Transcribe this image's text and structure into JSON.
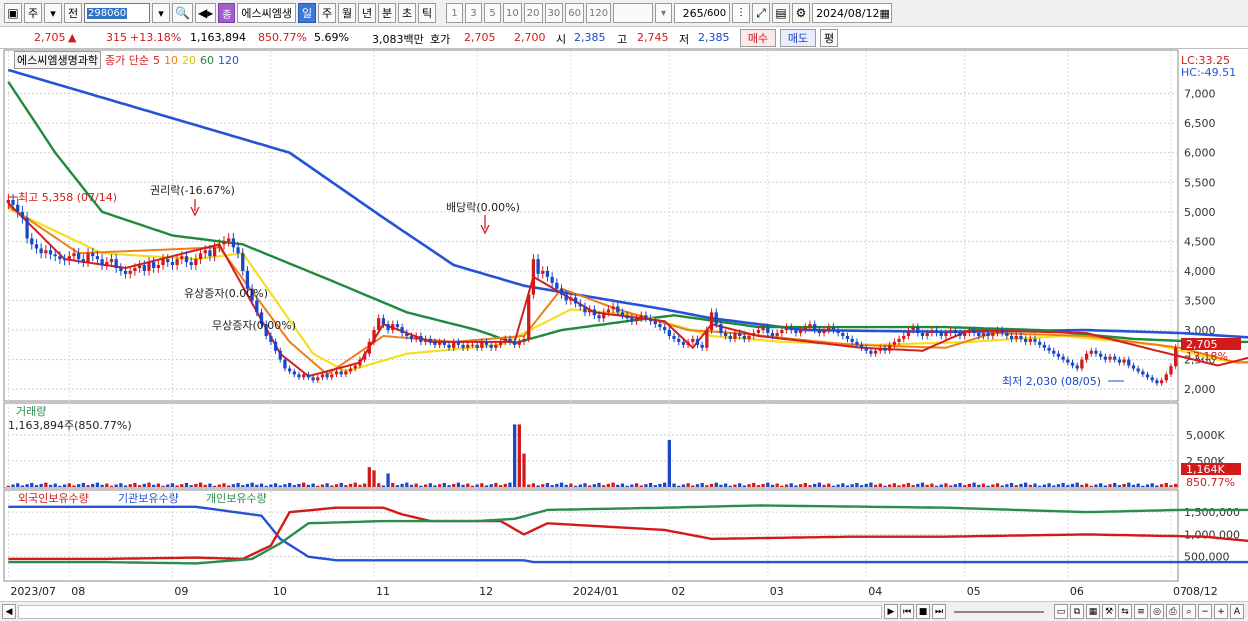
{
  "toolbar": {
    "period_main": "주",
    "prefix": "전",
    "code": "298060",
    "name_tag": "종",
    "stock_name": "에스씨엠생",
    "periods": [
      "일",
      "주",
      "월",
      "년",
      "분",
      "초",
      "틱"
    ],
    "active_period": "일",
    "intervals": [
      "1",
      "3",
      "5",
      "10",
      "20",
      "30",
      "60",
      "120"
    ],
    "count": "265",
    "count_total": "/600",
    "date": "2024/08/12"
  },
  "quote": {
    "price": "2,705",
    "arrow": "▲",
    "change": "315",
    "change_pct": "+13.18%",
    "volume": "1,163,894",
    "volume_pct": "850.77%",
    "turnover": "5.69%",
    "amount": "3,083백만",
    "hoga_label": "호가",
    "ask": "2,705",
    "bid": "2,700",
    "open_label": "시",
    "open": "2,385",
    "high_label": "고",
    "high": "2,745",
    "low_label": "저",
    "low": "2,385",
    "buy_label": "매수",
    "sell_label": "매도",
    "eval_label": "평"
  },
  "legend": {
    "stock": "에스씨엠생명과학",
    "ma_label": "종가 단순",
    "ma_periods": [
      "5",
      "10",
      "20",
      "60",
      "120"
    ]
  },
  "colors": {
    "ma5": "#d31f1f",
    "ma10": "#f07d1a",
    "ma20": "#f3df22",
    "ma60": "#1f8a3a",
    "ma120": "#2453d6",
    "up": "#d21a1a",
    "down": "#1a46c8",
    "foreign": "#2453d6",
    "institution": "#d21a1a",
    "individual": "#2c8c4f"
  },
  "right_labels": {
    "lc": "LC:33.25",
    "hc": "HC:-49.51",
    "price_tag": "2,705",
    "pct_tag": "13.18%",
    "vol_tag": "1,164K",
    "vol_pct_tag": "850.77%"
  },
  "annotations": {
    "high": "최고 5,358 (07/14)",
    "rights": "권리락(-16.67%)",
    "dividend": "배당락(0.00%)",
    "paid_increase": "유상증자(0.00%)",
    "free_increase": "무상증자(0.00%)",
    "low": "최저 2,030 (08/05)"
  },
  "volume_panel": {
    "title": "거래량",
    "info": "1,163,894주(850.77%)"
  },
  "holdings_panel": {
    "legend": [
      "외국인보유수량",
      "기관보유수량",
      "개인보유수량"
    ]
  },
  "chart_data": {
    "type": "line",
    "title": "",
    "price_axis": {
      "ticks": [
        2000,
        2500,
        3000,
        3500,
        4000,
        4500,
        5000,
        5500,
        6000,
        6500,
        7000
      ],
      "tick_labels": [
        "2,000",
        "2,500",
        "3,000",
        "3,500",
        "4,000",
        "4,500",
        "5,000",
        "5,500",
        "6,000",
        "6,500",
        "7,000"
      ],
      "ylim": [
        1800,
        7450
      ]
    },
    "volume_axis": {
      "ticks": [
        2500000,
        5000000
      ],
      "tick_labels": [
        "2,500K",
        "5,000K"
      ],
      "ylim": [
        0,
        7000000
      ]
    },
    "holdings_axis": {
      "ticks": [
        500000,
        1000000,
        1500000
      ],
      "tick_labels": [
        "500,000",
        "1,000,000",
        "1,500,000"
      ],
      "ylim": [
        0,
        1750000
      ]
    },
    "x_labels": [
      "2023/07",
      "08",
      "09",
      "10",
      "11",
      "12",
      "2024/01",
      "02",
      "03",
      "04",
      "05",
      "06",
      "07",
      "08",
      "08/12"
    ],
    "x_label_index": [
      0,
      13,
      35,
      56,
      78,
      100,
      120,
      141,
      162,
      183,
      204,
      226,
      248,
      269,
      285
    ],
    "close": [
      5200,
      5120,
      5000,
      4900,
      4550,
      4450,
      4380,
      4300,
      4350,
      4280,
      4250,
      4200,
      4180,
      4250,
      4300,
      4200,
      4150,
      4300,
      4250,
      4200,
      4100,
      4150,
      4200,
      4050,
      4000,
      3950,
      4000,
      4050,
      4100,
      4000,
      4150,
      4050,
      4100,
      4200,
      4150,
      4100,
      4200,
      4250,
      4150,
      4100,
      4200,
      4300,
      4350,
      4250,
      4400,
      4450,
      4500,
      4550,
      4400,
      4300,
      4000,
      3700,
      3500,
      3300,
      3100,
      2900,
      2800,
      2650,
      2500,
      2350,
      2300,
      2250,
      2200,
      2250,
      2200,
      2150,
      2200,
      2250,
      2200,
      2250,
      2300,
      2250,
      2300,
      2350,
      2400,
      2500,
      2600,
      2800,
      3000,
      3200,
      3100,
      3000,
      3100,
      3050,
      2950,
      2900,
      2850,
      2900,
      2800,
      2850,
      2800,
      2750,
      2800,
      2750,
      2700,
      2800,
      2750,
      2700,
      2750,
      2750,
      2700,
      2800,
      2750,
      2700,
      2750,
      2800,
      2850,
      2800,
      2750,
      2800,
      2850,
      3600,
      4200,
      3950,
      4000,
      3900,
      3800,
      3700,
      3600,
      3500,
      3550,
      3450,
      3400,
      3300,
      3350,
      3250,
      3200,
      3300,
      3350,
      3400,
      3300,
      3250,
      3200,
      3150,
      3200,
      3250,
      3200,
      3150,
      3100,
      3050,
      3000,
      2900,
      2850,
      2800,
      2750,
      2800,
      2850,
      2750,
      2700,
      3000,
      3300,
      3100,
      2950,
      2900,
      2850,
      2950,
      2900,
      2850,
      2900,
      2950,
      3000,
      3050,
      2950,
      2900,
      2950,
      3000,
      3050,
      3000,
      2950,
      3000,
      3050,
      3100,
      3000,
      2950,
      3000,
      3050,
      3000,
      2950,
      2900,
      2850,
      2800,
      2750,
      2700,
      2650,
      2600,
      2650,
      2700,
      2650,
      2750,
      2800,
      2850,
      2900,
      3000,
      3050,
      2950,
      2900,
      2950,
      3000,
      2950,
      2900,
      2950,
      3000,
      2950,
      2900,
      2950,
      3000,
      2950,
      2900,
      2950,
      2900,
      2950,
      3000,
      2950,
      2900,
      2850,
      2900,
      2850,
      2800,
      2850,
      2800,
      2750,
      2700,
      2650,
      2600,
      2550,
      2500,
      2450,
      2400,
      2350,
      2500,
      2600,
      2650,
      2600,
      2550,
      2500,
      2550,
      2500,
      2450,
      2500,
      2400,
      2350,
      2300,
      2250,
      2200,
      2150,
      2100,
      2150,
      2250,
      2390,
      2705
    ],
    "ma5_anchor": [
      [
        0,
        5150
      ],
      [
        12,
        4200
      ],
      [
        25,
        4050
      ],
      [
        45,
        4450
      ],
      [
        58,
        2600
      ],
      [
        64,
        2220
      ],
      [
        75,
        2450
      ],
      [
        80,
        3100
      ],
      [
        90,
        2800
      ],
      [
        108,
        2800
      ],
      [
        112,
        3900
      ],
      [
        125,
        3300
      ],
      [
        140,
        3150
      ],
      [
        146,
        2700
      ],
      [
        150,
        3100
      ],
      [
        160,
        2900
      ],
      [
        182,
        2700
      ],
      [
        195,
        2650
      ],
      [
        205,
        3000
      ],
      [
        230,
        2950
      ],
      [
        245,
        2650
      ],
      [
        258,
        2400
      ],
      [
        266,
        2560
      ],
      [
        276,
        2250
      ],
      [
        284,
        2400
      ]
    ],
    "ma10_anchor": [
      [
        0,
        5100
      ],
      [
        15,
        4300
      ],
      [
        45,
        4400
      ],
      [
        60,
        2800
      ],
      [
        68,
        2250
      ],
      [
        80,
        2900
      ],
      [
        95,
        2800
      ],
      [
        110,
        2900
      ],
      [
        118,
        3700
      ],
      [
        130,
        3350
      ],
      [
        145,
        3000
      ],
      [
        155,
        2950
      ],
      [
        180,
        2750
      ],
      [
        200,
        2700
      ],
      [
        210,
        2950
      ],
      [
        230,
        2900
      ],
      [
        250,
        2700
      ],
      [
        262,
        2450
      ],
      [
        270,
        2480
      ],
      [
        284,
        2380
      ]
    ],
    "ma20_anchor": [
      [
        0,
        5050
      ],
      [
        20,
        4300
      ],
      [
        40,
        4200
      ],
      [
        50,
        4300
      ],
      [
        65,
        2600
      ],
      [
        72,
        2300
      ],
      [
        85,
        2600
      ],
      [
        105,
        2750
      ],
      [
        120,
        3350
      ],
      [
        135,
        3250
      ],
      [
        150,
        2900
      ],
      [
        165,
        2800
      ],
      [
        185,
        2750
      ],
      [
        205,
        2800
      ],
      [
        225,
        2900
      ],
      [
        245,
        2750
      ],
      [
        258,
        2500
      ],
      [
        270,
        2400
      ],
      [
        284,
        2400
      ]
    ],
    "ma60_anchor": [
      [
        0,
        7200
      ],
      [
        10,
        6000
      ],
      [
        20,
        5000
      ],
      [
        35,
        4600
      ],
      [
        50,
        4450
      ],
      [
        70,
        3800
      ],
      [
        85,
        3300
      ],
      [
        100,
        3000
      ],
      [
        108,
        2780
      ],
      [
        118,
        3000
      ],
      [
        132,
        3150
      ],
      [
        142,
        3250
      ],
      [
        160,
        3050
      ],
      [
        180,
        3050
      ],
      [
        200,
        3050
      ],
      [
        220,
        3000
      ],
      [
        240,
        2850
      ],
      [
        255,
        2800
      ],
      [
        270,
        2800
      ],
      [
        284,
        2700
      ]
    ],
    "ma120_anchor": [
      [
        0,
        7400
      ],
      [
        30,
        6700
      ],
      [
        60,
        6000
      ],
      [
        80,
        4900
      ],
      [
        95,
        4100
      ],
      [
        110,
        3750
      ],
      [
        125,
        3550
      ],
      [
        140,
        3350
      ],
      [
        150,
        3200
      ],
      [
        170,
        3000
      ],
      [
        200,
        2970
      ],
      [
        230,
        3000
      ],
      [
        250,
        2950
      ],
      [
        270,
        2850
      ],
      [
        284,
        2820
      ]
    ],
    "volume_spikes": [
      [
        108,
        6000000
      ],
      [
        109,
        6000000
      ],
      [
        110,
        3200000
      ],
      [
        141,
        4500000
      ],
      [
        77,
        1900000
      ],
      [
        78,
        1600000
      ],
      [
        81,
        1300000
      ],
      [
        256,
        3200000
      ],
      [
        259,
        1500000
      ],
      [
        284,
        1163894
      ]
    ],
    "holdings": {
      "foreign": [
        [
          0,
          1620000
        ],
        [
          40,
          1620000
        ],
        [
          54,
          1420000
        ],
        [
          58,
          900000
        ],
        [
          64,
          500000
        ],
        [
          70,
          420000
        ],
        [
          110,
          420000
        ],
        [
          112,
          380000
        ],
        [
          284,
          380000
        ]
      ],
      "institution": [
        [
          0,
          450000
        ],
        [
          20,
          450000
        ],
        [
          40,
          480000
        ],
        [
          50,
          450000
        ],
        [
          56,
          750000
        ],
        [
          60,
          1500000
        ],
        [
          70,
          1600000
        ],
        [
          80,
          1600000
        ],
        [
          84,
          1450000
        ],
        [
          90,
          1300000
        ],
        [
          105,
          1300000
        ],
        [
          110,
          1000000
        ],
        [
          115,
          1250000
        ],
        [
          140,
          1100000
        ],
        [
          150,
          900000
        ],
        [
          180,
          950000
        ],
        [
          200,
          950000
        ],
        [
          230,
          1000000
        ],
        [
          255,
          950000
        ],
        [
          265,
          850000
        ],
        [
          284,
          1000000
        ]
      ],
      "individual": [
        [
          0,
          380000
        ],
        [
          20,
          380000
        ],
        [
          40,
          350000
        ],
        [
          52,
          450000
        ],
        [
          58,
          800000
        ],
        [
          64,
          1250000
        ],
        [
          80,
          1300000
        ],
        [
          100,
          1300000
        ],
        [
          108,
          1350000
        ],
        [
          115,
          1550000
        ],
        [
          140,
          1600000
        ],
        [
          160,
          1650000
        ],
        [
          200,
          1600000
        ],
        [
          230,
          1500000
        ],
        [
          250,
          1550000
        ],
        [
          270,
          1550000
        ],
        [
          284,
          1450000
        ]
      ]
    }
  }
}
